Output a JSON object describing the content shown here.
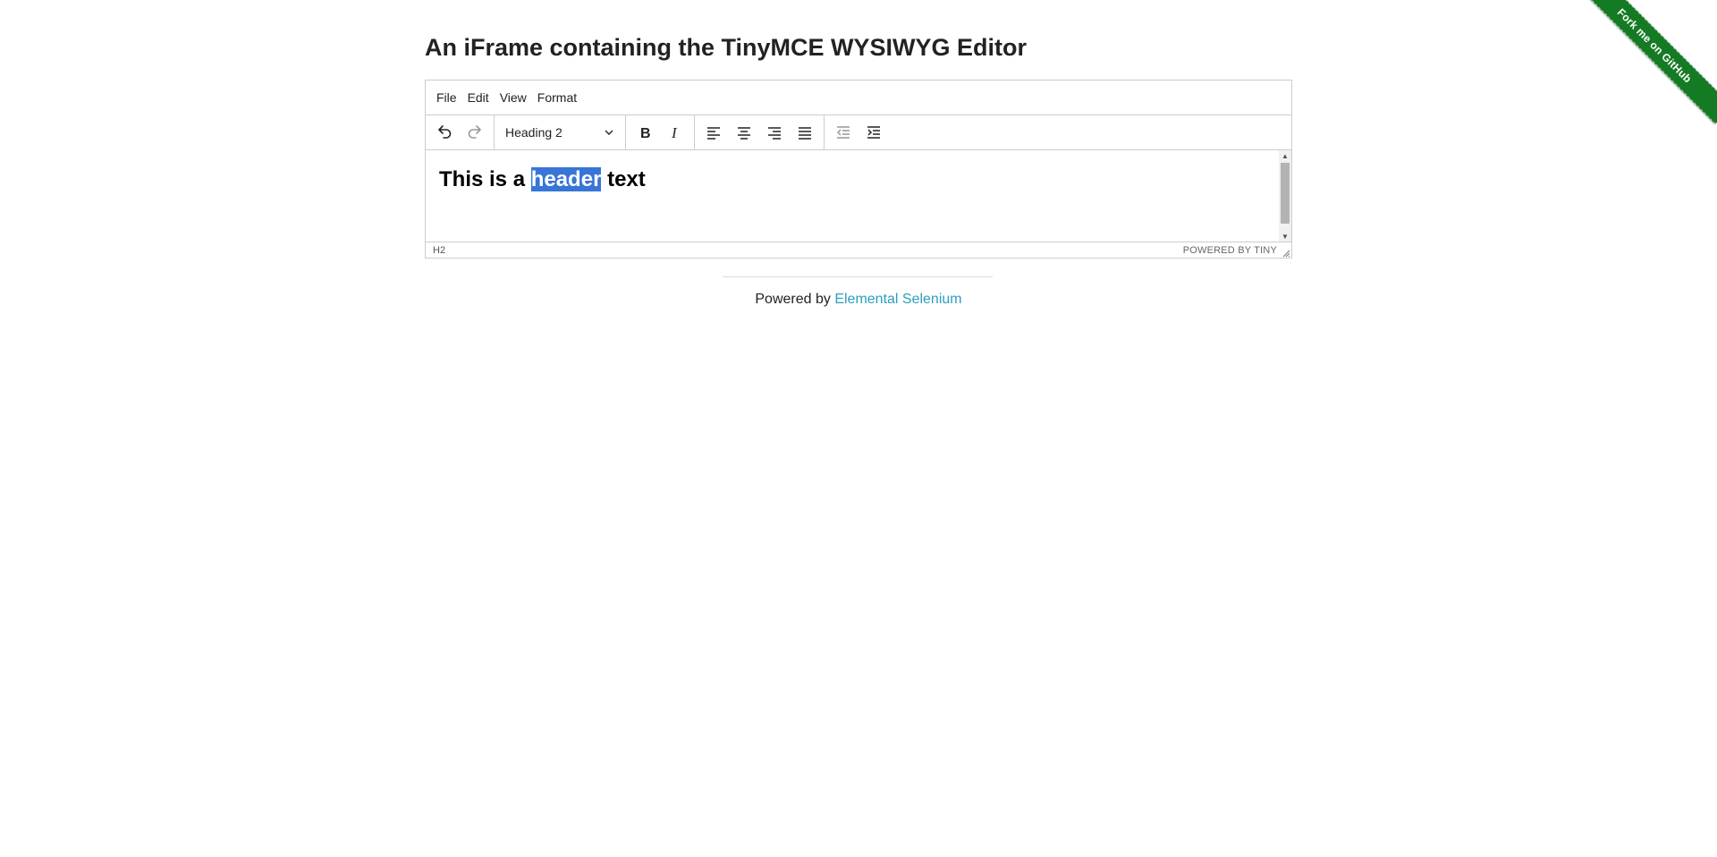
{
  "ribbon": {
    "label": "Fork me on GitHub",
    "color": "#157a24"
  },
  "page": {
    "title": "An iFrame containing the TinyMCE WYSIWYG Editor"
  },
  "editor": {
    "menubar": {
      "items": [
        "File",
        "Edit",
        "View",
        "Format"
      ]
    },
    "toolbar": {
      "block_format": "Heading 2",
      "icons": [
        "undo-icon",
        "redo-icon",
        "bold-icon",
        "italic-icon",
        "align-left-icon",
        "align-center-icon",
        "align-right-icon",
        "align-justify-icon",
        "outdent-icon",
        "indent-icon"
      ]
    },
    "content": {
      "before": "This is a ",
      "selected": "header",
      "after": " text",
      "selection_color": "#3875d7"
    },
    "statusbar": {
      "path": "H2",
      "branding": "POWERED BY TINY"
    }
  },
  "footer": {
    "prefix": "Powered by ",
    "link": "Elemental Selenium",
    "link_color": "#2a9fbf"
  }
}
